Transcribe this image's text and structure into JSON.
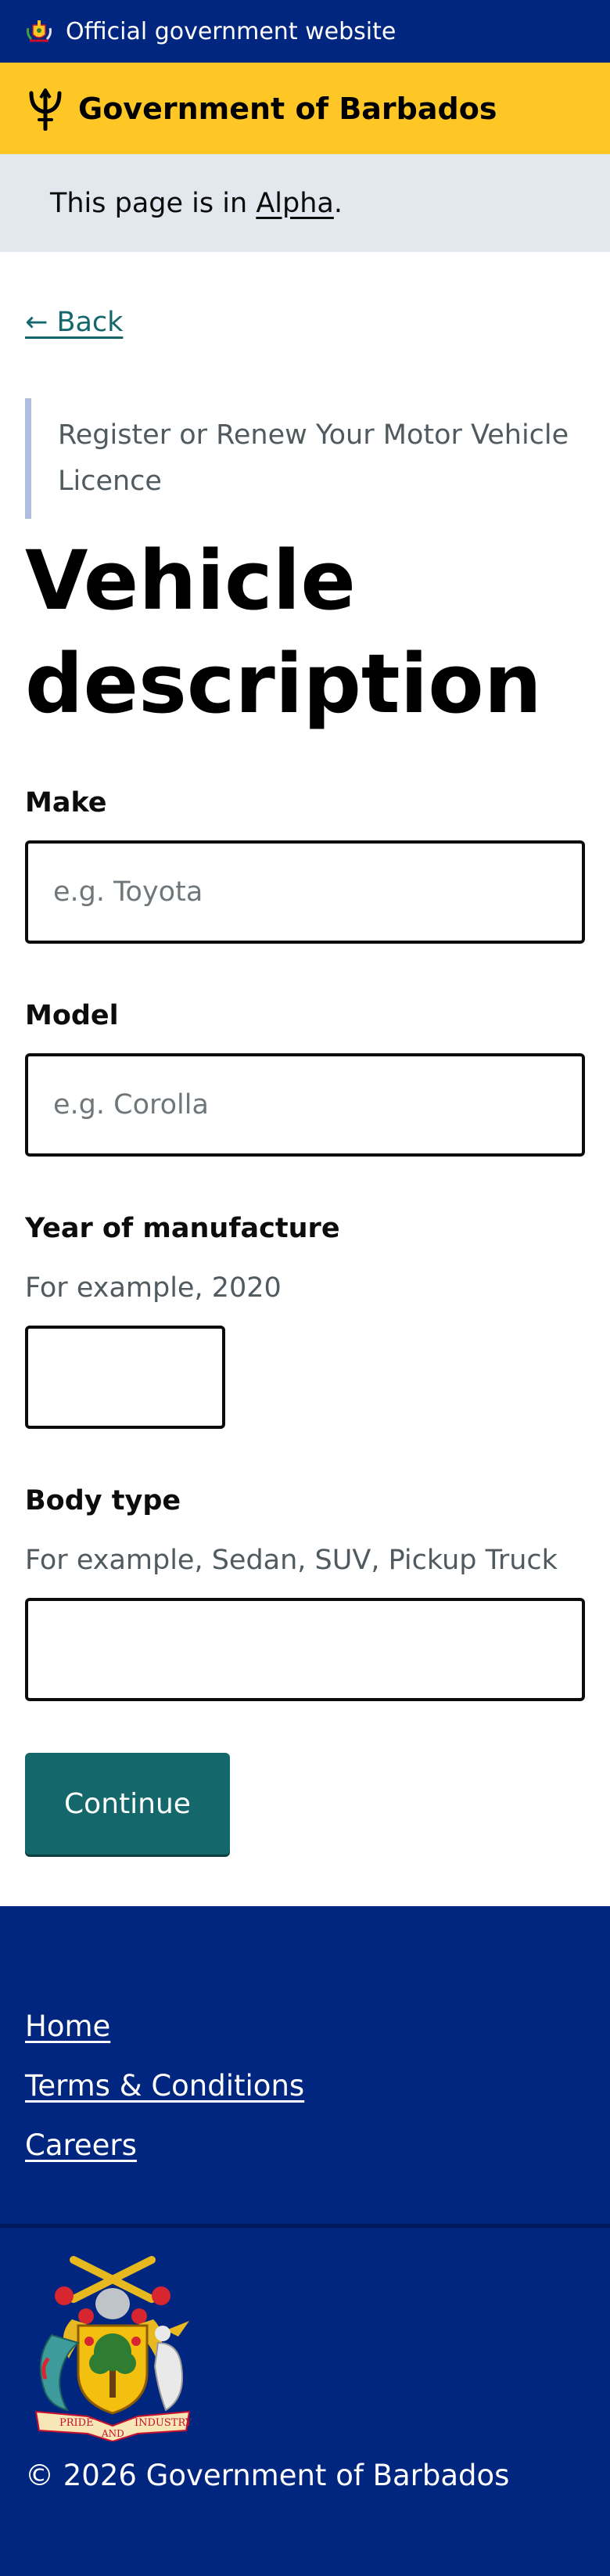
{
  "official_banner": {
    "text": "Official government website",
    "icon": "coat-of-arms-icon"
  },
  "header": {
    "title": "Government of Barbados",
    "icon": "trident-icon",
    "background": "#ffc726"
  },
  "phase_banner": {
    "prefix": "This page is in ",
    "phase": "Alpha",
    "suffix": "."
  },
  "back_link": "← Back",
  "caption": "Register or Renew Your Motor Vehicle Licence",
  "title": "Vehicle description",
  "fields": {
    "make": {
      "label": "Make",
      "placeholder": "e.g. Toyota",
      "value": ""
    },
    "model": {
      "label": "Model",
      "placeholder": "e.g. Corolla",
      "value": ""
    },
    "year": {
      "label": "Year of manufacture",
      "hint": "For example, 2020",
      "value": ""
    },
    "body_type": {
      "label": "Body type",
      "hint": "For example, Sedan, SUV, Pickup Truck",
      "value": ""
    }
  },
  "continue_label": "Continue",
  "footer": {
    "links": [
      "Home",
      "Terms & Conditions",
      "Careers"
    ],
    "copyright": "© 2026 Government of Barbados",
    "crest_icon": "coat-of-arms-icon",
    "crest_motto": [
      "PRIDE",
      "AND",
      "INDUSTRY"
    ]
  },
  "colors": {
    "brand_blue": "#00267f",
    "brand_yellow": "#ffc726",
    "button_teal": "#14686b",
    "link_teal": "#14686b"
  }
}
